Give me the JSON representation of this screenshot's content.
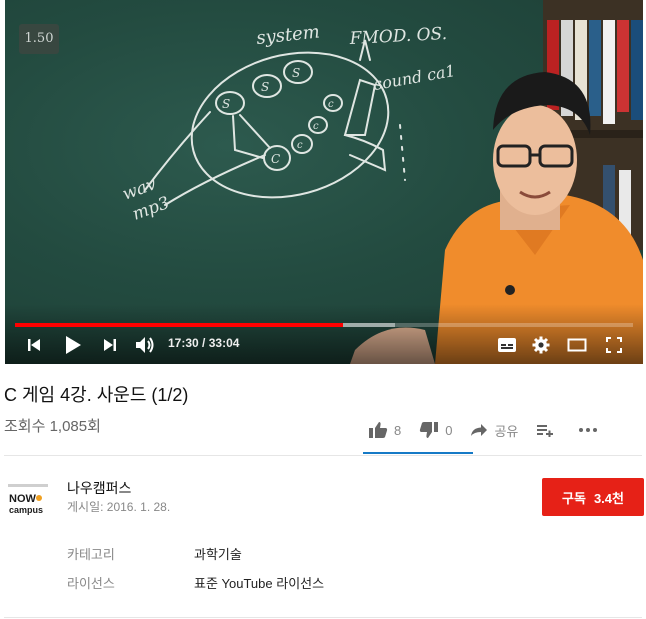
{
  "player": {
    "speed_badge": "1.50",
    "current_time": "17:30",
    "time_separator": "/",
    "duration": "33:04",
    "progress_played_fraction": 0.53,
    "progress_loaded_fraction": 0.615,
    "progress_color": "#ff0000",
    "chalkboard_text": {
      "system": "system",
      "fmod": "FMOD. OS.",
      "soundcard": "sound ca1",
      "wav": "wav",
      "mp3": "mp3"
    }
  },
  "video": {
    "title": "C 게임 4강. 사운드 (1/2)",
    "views": "조회수 1,085회"
  },
  "actions": {
    "like_count": "8",
    "dislike_count": "0",
    "share_label": "공유",
    "accent_color": "#167ac6"
  },
  "channel": {
    "name": "나우캠퍼스",
    "logo_text_top": "NOW",
    "logo_text_bottom": "campus",
    "published": "게시일: 2016. 1. 28."
  },
  "subscribe": {
    "label": "구독",
    "count": "3.4천",
    "color": "#e62117"
  },
  "meta": {
    "category_label": "카테고리",
    "category_value": "과학기술",
    "license_label": "라이선스",
    "license_value": "표준 YouTube 라이선스"
  }
}
